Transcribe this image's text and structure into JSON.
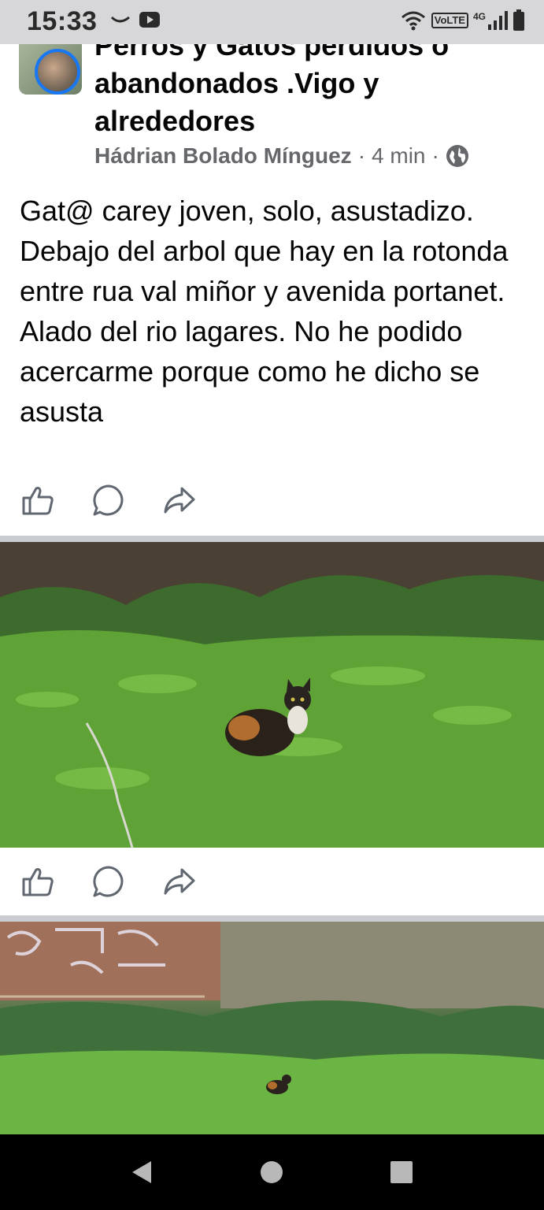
{
  "status_bar": {
    "time": "15:33",
    "volte": "VoLTE",
    "network": "4G"
  },
  "post": {
    "group_name": "Perros y Gatos perdidos o abandonados .Vigo y alrededores",
    "author": "Hádrian Bolado Mínguez",
    "separator": "·",
    "time_ago": "4 min",
    "privacy_icon": "globe-icon",
    "text": "Gat@ carey joven, solo, asustadizo. Debajo del arbol que hay en la rotonda entre rua val miñor y avenida portanet. Alado del rio lagares. No he podido acercarme porque como he dicho se asusta"
  },
  "actions": {
    "like_icon": "thumbs-up-icon",
    "comment_icon": "comment-icon",
    "share_icon": "share-icon"
  },
  "photos": [
    {
      "subject": "tortoiseshell-cat-in-grass"
    },
    {
      "subject": "cat-in-field-with-graffiti-wall"
    }
  ],
  "colors": {
    "accent": "#1877f2",
    "meta_text": "#65676b",
    "text": "#050505",
    "icon": "#606770"
  }
}
